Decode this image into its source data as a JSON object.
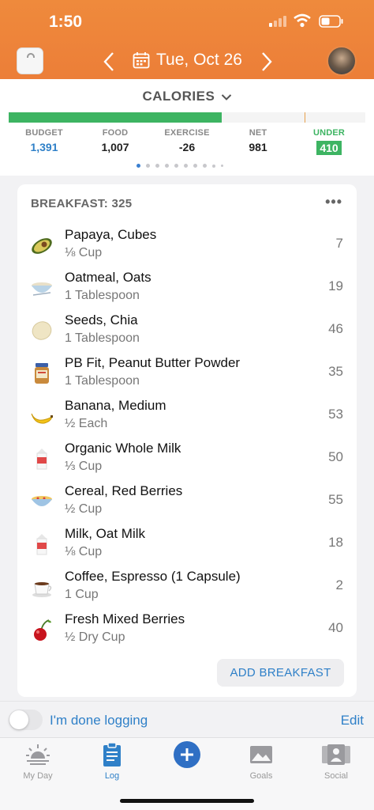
{
  "status": {
    "time": "1:50"
  },
  "nav": {
    "date": "Tue, Oct 26",
    "prev_icon": "chevron-left-icon",
    "next_icon": "chevron-right-icon"
  },
  "calories": {
    "title": "CALORIES",
    "progress_fraction": 0.597,
    "marker_fraction": 0.83,
    "stats": {
      "budget": {
        "label": "BUDGET",
        "value": "1,391"
      },
      "food": {
        "label": "FOOD",
        "value": "1,007"
      },
      "exercise": {
        "label": "EXERCISE",
        "value": "-26"
      },
      "net": {
        "label": "NET",
        "value": "981"
      },
      "under": {
        "label": "UNDER",
        "value": "410"
      }
    }
  },
  "meal": {
    "title": "BREAKFAST: 325",
    "more_label": "•••",
    "add_label": "ADD BREAKFAST",
    "items": [
      {
        "name": "Papaya, Cubes",
        "qty": "⅛ Cup",
        "cal": "7",
        "icon": "avocado-icon"
      },
      {
        "name": "Oatmeal, Oats",
        "qty": "1 Tablespoon",
        "cal": "19",
        "icon": "bowl-icon"
      },
      {
        "name": "Seeds, Chia",
        "qty": "1 Tablespoon",
        "cal": "46",
        "icon": "seed-icon"
      },
      {
        "name": "PB Fit, Peanut Butter Powder",
        "qty": "1 Tablespoon",
        "cal": "35",
        "icon": "jar-icon"
      },
      {
        "name": "Banana, Medium",
        "qty": "½ Each",
        "cal": "53",
        "icon": "banana-icon"
      },
      {
        "name": "Organic Whole Milk",
        "qty": "⅓ Cup",
        "cal": "50",
        "icon": "milk-carton-icon"
      },
      {
        "name": "Cereal, Red Berries",
        "qty": "½ Cup",
        "cal": "55",
        "icon": "cereal-bowl-icon"
      },
      {
        "name": "Milk, Oat Milk",
        "qty": "⅛ Cup",
        "cal": "18",
        "icon": "milk-carton-icon"
      },
      {
        "name": "Coffee, Espresso (1 Capsule)",
        "qty": "1 Cup",
        "cal": "2",
        "icon": "coffee-cup-icon"
      },
      {
        "name": "Fresh Mixed Berries",
        "qty": "½ Dry Cup",
        "cal": "40",
        "icon": "cherry-icon"
      }
    ]
  },
  "done": {
    "label": "I'm done logging",
    "edit": "Edit"
  },
  "tabs": [
    {
      "label": "My Day",
      "icon": "sunrise-icon"
    },
    {
      "label": "Log",
      "icon": "clipboard-icon"
    },
    {
      "label": "",
      "icon": "plus-icon"
    },
    {
      "label": "Goals",
      "icon": "goals-icon"
    },
    {
      "label": "Social",
      "icon": "social-icon"
    }
  ]
}
